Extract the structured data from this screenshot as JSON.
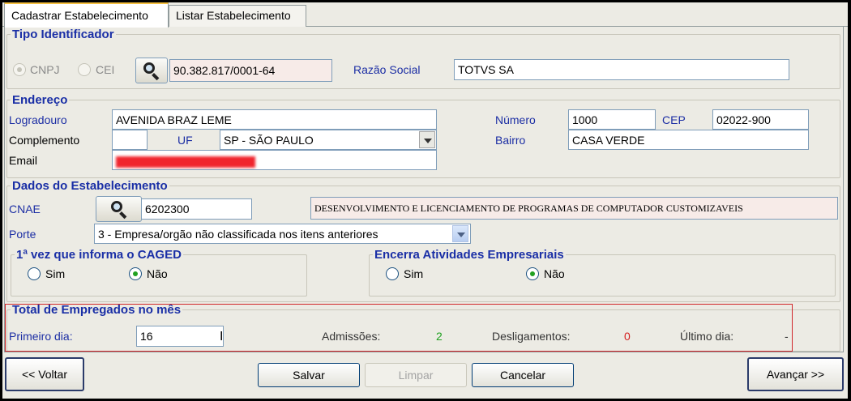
{
  "tabs": [
    {
      "label": "Cadastrar Estabelecimento",
      "active": true
    },
    {
      "label": "Listar Estabelecimento",
      "active": false
    }
  ],
  "tipo": {
    "legend": "Tipo Identificador",
    "cnpj_label": "CNPJ",
    "cei_label": "CEI",
    "selected": "CNPJ",
    "identificador_value": "90.382.817/0001-64",
    "razao_label": "Razão Social",
    "razao_value": "TOTVS SA"
  },
  "endereco": {
    "legend": "Endereço",
    "logradouro_label": "Logradouro",
    "logradouro_value": "AVENIDA BRAZ LEME",
    "numero_label": "Número",
    "numero_value": "1000",
    "cep_label": "CEP",
    "cep_value": "02022-900",
    "complemento_label": "Complemento",
    "complemento_value": "",
    "uf_label": "UF",
    "uf_value": "SP - SÃO PAULO",
    "bairro_label": "Bairro",
    "bairro_value": "CASA VERDE",
    "email_label": "Email"
  },
  "dados": {
    "legend": "Dados do Estabelecimento",
    "cnae_label": "CNAE",
    "cnae_value": "6202300",
    "cnae_desc": "DESENVOLVIMENTO E LICENCIAMENTO DE PROGRAMAS DE COMPUTADOR CUSTOMIZAVEIS",
    "porte_label": "Porte",
    "porte_value": "3 - Empresa/orgão não classificada nos itens anteriores"
  },
  "caged": {
    "legend": "1ª vez que informa o CAGED",
    "sim": "Sim",
    "nao": "Não",
    "selected": "Não"
  },
  "encerra": {
    "legend": "Encerra Atividades Empresariais",
    "sim": "Sim",
    "nao": "Não",
    "selected": "Não"
  },
  "total": {
    "legend": "Total de Empregados no mês",
    "primeiro_label": "Primeiro dia:",
    "primeiro_value": "16",
    "admissoes_label": "Admissões:",
    "admissoes_value": "2",
    "desligamentos_label": "Desligamentos:",
    "desligamentos_value": "0",
    "ultimo_label": "Último dia:",
    "ultimo_value": "-"
  },
  "buttons": {
    "voltar": "<< Voltar",
    "salvar": "Salvar",
    "limpar": "Limpar",
    "cancelar": "Cancelar",
    "avancar": "Avançar >>"
  },
  "colors": {
    "label_blue": "#1c2ea4",
    "admissoes_green": "#21a121",
    "desligamentos_red": "#d42020",
    "highlight_border": "#d0262a"
  }
}
